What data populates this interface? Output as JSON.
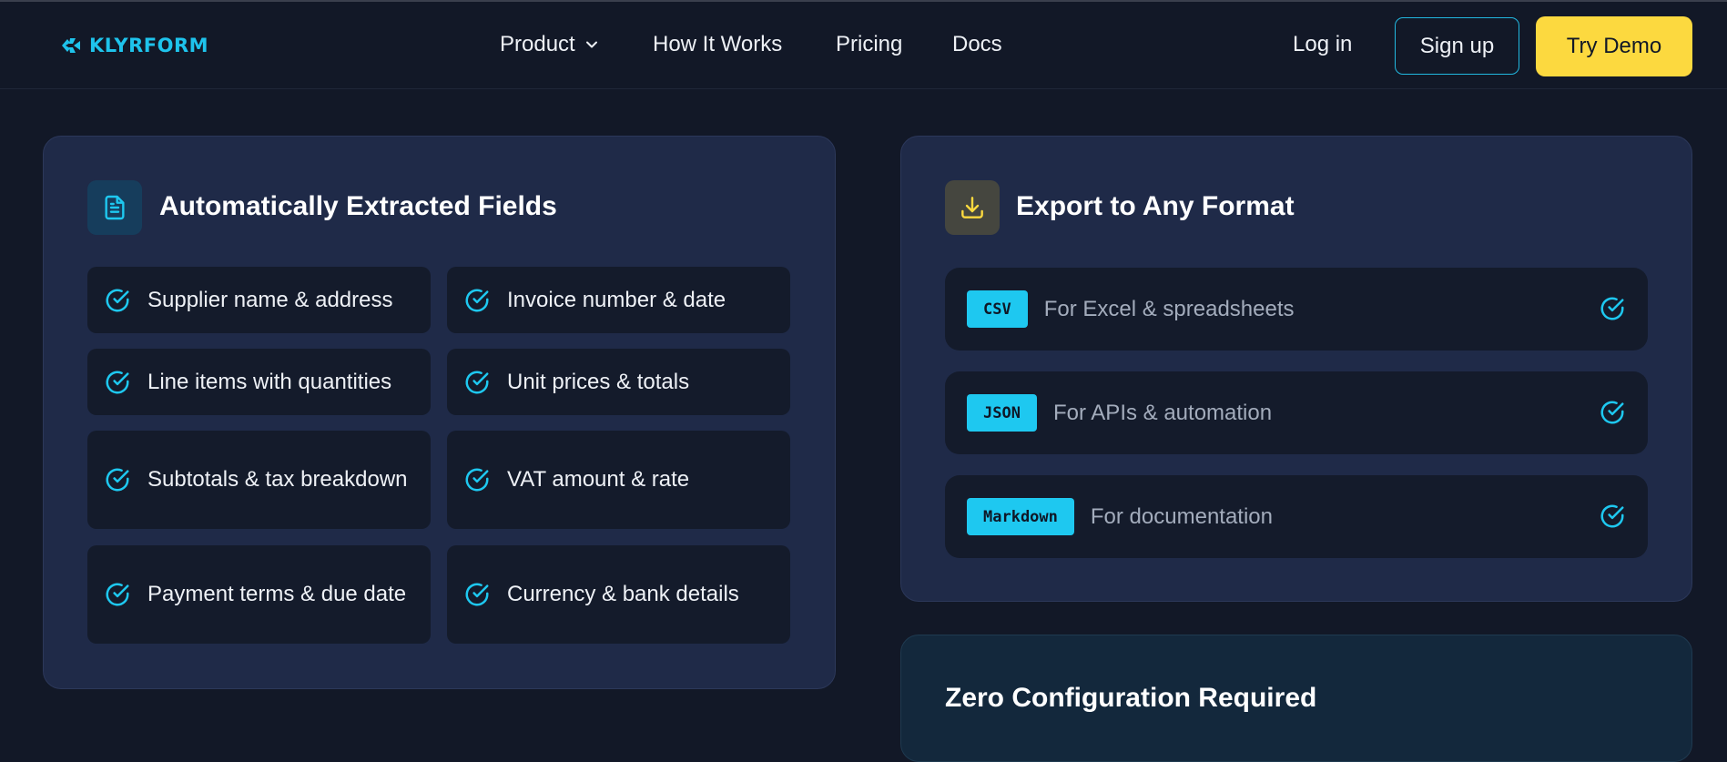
{
  "brand": {
    "name": "KLYRFORM",
    "color": "#1ec3ec",
    "icon": "klyrform-logo-icon"
  },
  "nav": {
    "items": [
      {
        "label": "Product",
        "icon": "chevron-down-icon"
      },
      {
        "label": "How It Works"
      },
      {
        "label": "Pricing"
      },
      {
        "label": "Docs"
      }
    ],
    "login": "Log in",
    "signup": "Sign up",
    "demo": "Try Demo"
  },
  "fields_card": {
    "title": "Automatically Extracted Fields",
    "icon": "document-icon",
    "items": [
      {
        "label": "Supplier name & address",
        "icon": "check-circle-icon"
      },
      {
        "label": "Invoice number & date",
        "icon": "check-circle-icon"
      },
      {
        "label": "Line items with quantities",
        "icon": "check-circle-icon"
      },
      {
        "label": "Unit prices & totals",
        "icon": "check-circle-icon"
      },
      {
        "label": "Subtotals & tax breakdown",
        "icon": "check-circle-icon"
      },
      {
        "label": "VAT amount & rate",
        "icon": "check-circle-icon"
      },
      {
        "label": "Payment terms & due date",
        "icon": "check-circle-icon"
      },
      {
        "label": "Currency & bank details",
        "icon": "check-circle-icon"
      }
    ]
  },
  "export_card": {
    "title": "Export to Any Format",
    "icon": "download-icon",
    "formats": [
      {
        "badge": "CSV",
        "desc": "For Excel & spreadsheets"
      },
      {
        "badge": "JSON",
        "desc": "For APIs & automation"
      },
      {
        "badge": "Markdown",
        "desc": "For documentation"
      }
    ]
  },
  "zero_card": {
    "title": "Zero Configuration Required"
  },
  "colors": {
    "background": "#121827",
    "card": "#1f2a48",
    "accent": "#1ec8f0",
    "cta": "#fcd93f"
  }
}
